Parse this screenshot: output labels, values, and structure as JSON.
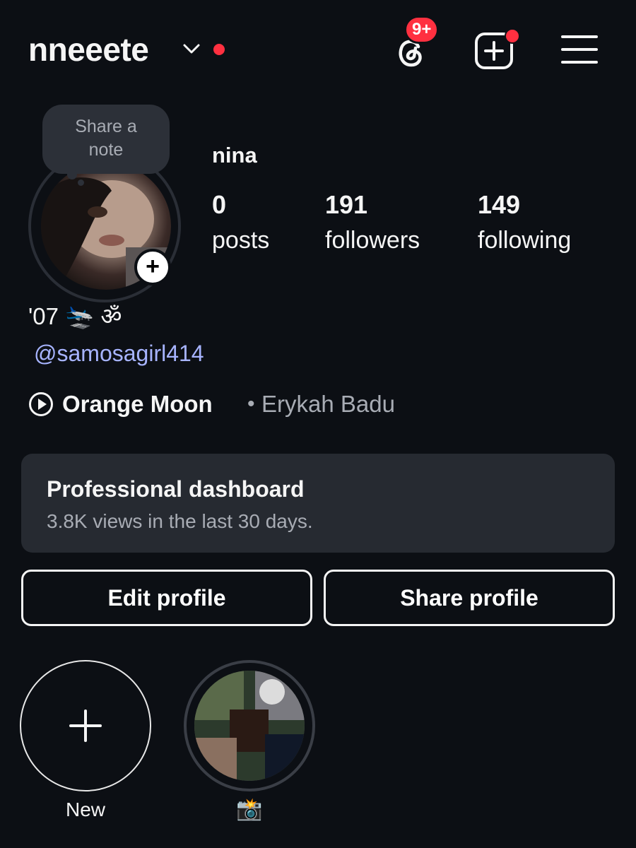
{
  "header": {
    "username": "nneeete",
    "notification_badge": "9+",
    "icons": [
      "chevron-down-icon",
      "threads-icon",
      "create-post-icon",
      "menu-icon"
    ]
  },
  "profile": {
    "note_bubble": "Share a\nnote",
    "name": "nina",
    "stats": [
      {
        "value": "0",
        "label": "posts"
      },
      {
        "value": "191",
        "label": "followers"
      },
      {
        "value": "149",
        "label": "following"
      }
    ],
    "bio": "'07 🛬 ॐ",
    "mention": "@samosagirl414",
    "music": {
      "song": "Orange Moon",
      "separator": "•",
      "artist": "Erykah Badu"
    }
  },
  "dashboard": {
    "title": "Professional dashboard",
    "subtitle": "3.8K views in the last 30 days."
  },
  "buttons": {
    "edit": "Edit profile",
    "share": "Share profile"
  },
  "highlights": [
    {
      "label": "New"
    },
    {
      "label": "📸"
    }
  ],
  "colors": {
    "background": "#0c0f14",
    "accent_red": "#ff3040",
    "mention_blue": "#a7b4ff",
    "card": "#262a31"
  }
}
